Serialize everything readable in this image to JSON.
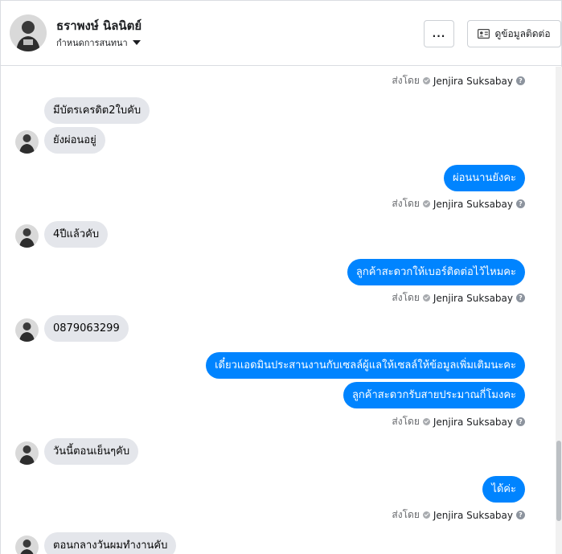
{
  "header": {
    "name": "ธราพงษ์ นิลนิตย์",
    "subtitle": "กำหนดการสนทนา",
    "more_label": "...",
    "contact_label": "ดูข้อมูลติดต่อ"
  },
  "sent_by": {
    "prefix": "ส่งโดย",
    "name": "Jenjira Suksabay"
  },
  "messages": [
    "มีบัตรเครดิต2ใบคับ",
    "ยังผ่อนอยู่",
    "ผ่อนนานยังคะ",
    "4ปีแล้วคับ",
    "ลูกค้าสะดวกให้เบอร์ติดต่อไว้ไหมคะ",
    "0879063299",
    "เดี๋ยวแอดมินประสานงานกับเซลล์ผู้แลให้เซลล์ให้ข้อมูลเพิ่มเติมนะคะ",
    "ลูกค้าสะดวกรับสายประมาณกี่โมงคะ",
    "วันนี้ตอนเย็นๆคับ",
    "ได้ค่ะ",
    "ตอนกลางวันผมทำงานคับ"
  ],
  "colors": {
    "outgoing": "#0084ff",
    "incoming": "#e4e6eb"
  },
  "icons": {
    "more": "ellipsis-icon",
    "contact": "contact-card-icon",
    "verified": "check-circle-icon",
    "help": "question-circle-icon"
  }
}
